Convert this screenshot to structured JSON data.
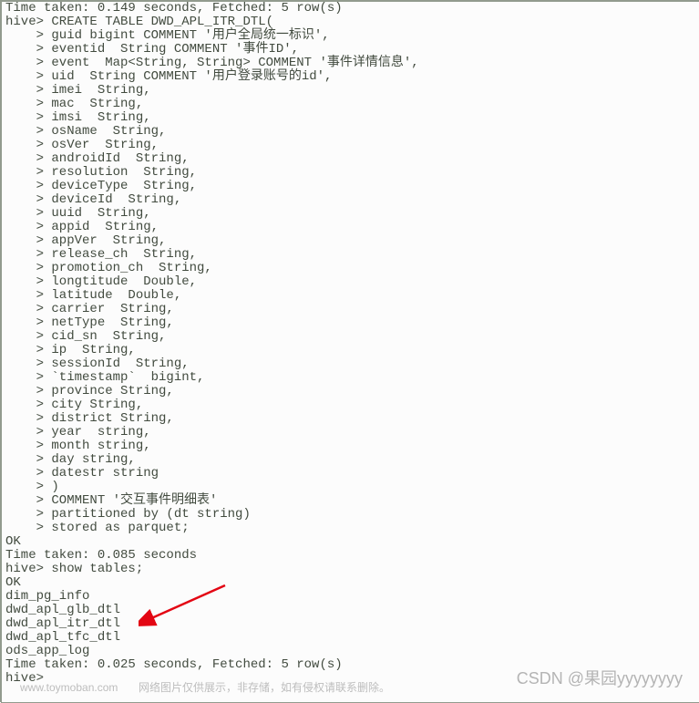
{
  "terminal": {
    "lines": [
      "Time taken: 0.149 seconds, Fetched: 5 row(s)",
      "hive> CREATE TABLE DWD_APL_ITR_DTL(",
      "    > guid bigint COMMENT '用户全局统一标识',",
      "    > eventid  String COMMENT '事件ID',",
      "    > event  Map<String, String> COMMENT '事件详情信息',",
      "    > uid  String COMMENT '用户登录账号的id',",
      "    > imei  String,",
      "    > mac  String,",
      "    > imsi  String,",
      "    > osName  String,",
      "    > osVer  String,",
      "    > androidId  String,",
      "    > resolution  String,",
      "    > deviceType  String,",
      "    > deviceId  String,",
      "    > uuid  String,",
      "    > appid  String,",
      "    > appVer  String,",
      "    > release_ch  String,",
      "    > promotion_ch  String,",
      "    > longtitude  Double,",
      "    > latitude  Double,",
      "    > carrier  String,",
      "    > netType  String,",
      "    > cid_sn  String,",
      "    > ip  String,",
      "    > sessionId  String,",
      "    > `timestamp`  bigint,",
      "    > province String,",
      "    > city String,",
      "    > district String,",
      "    > year  string,",
      "    > month string,",
      "    > day string,",
      "    > datestr string",
      "    > )",
      "    > COMMENT '交互事件明细表'",
      "    > partitioned by (dt string)",
      "    > stored as parquet;",
      "OK",
      "Time taken: 0.085 seconds",
      "hive> show tables;",
      "OK",
      "dim_pg_info",
      "dwd_apl_glb_dtl",
      "dwd_apl_itr_dtl",
      "dwd_apl_tfc_dtl",
      "ods_app_log",
      "Time taken: 0.025 seconds, Fetched: 5 row(s)",
      "hive>"
    ]
  },
  "watermarks": {
    "left": "www.toymoban.com",
    "center": "网络图片仅供展示，非存储，如有侵权请联系删除。",
    "right": "CSDN @果园yyyyyyyy"
  },
  "arrow_color": "#e30613"
}
